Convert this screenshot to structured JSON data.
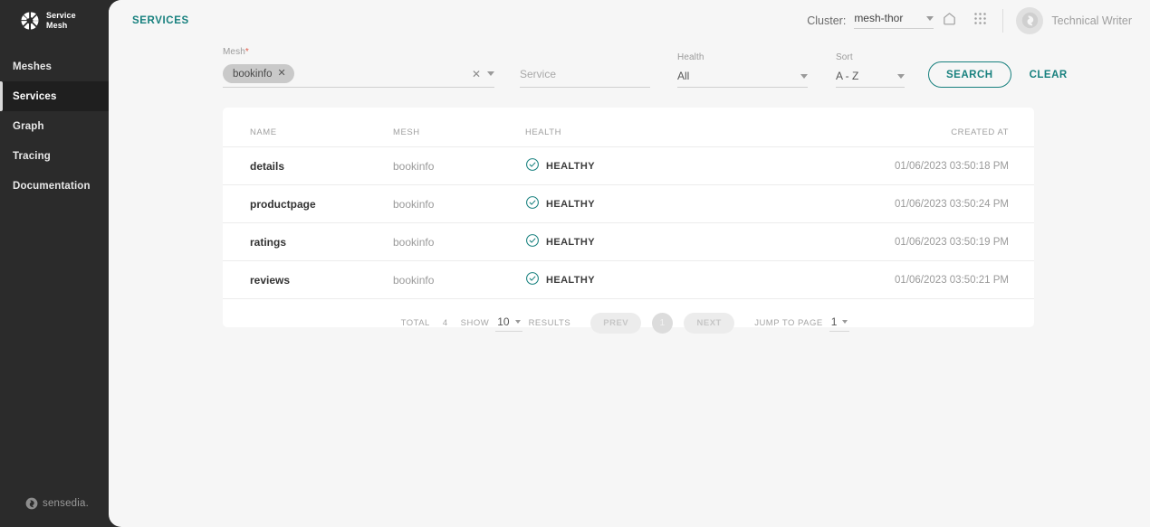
{
  "sidebar": {
    "brand": {
      "line1": "Service",
      "line2": "Mesh",
      "logo_icon": "service-mesh-logo-icon"
    },
    "items": [
      {
        "label": "Meshes",
        "active": false
      },
      {
        "label": "Services",
        "active": true
      },
      {
        "label": "Graph",
        "active": false
      },
      {
        "label": "Tracing",
        "active": false
      },
      {
        "label": "Documentation",
        "active": false
      }
    ],
    "footer": {
      "brand": "sensedia",
      "dot": ".",
      "logo_icon": "sensedia-logo-icon"
    }
  },
  "header": {
    "breadcrumb": "SERVICES",
    "cluster_label": "Cluster:",
    "cluster_value": "mesh-thor",
    "home_icon": "home-icon",
    "apps_icon": "apps-grid-icon",
    "user_name": "Technical Writer",
    "avatar_icon": "sensedia-avatar-icon"
  },
  "filters": {
    "mesh": {
      "label": "Mesh",
      "required": "*",
      "chip": "bookinfo",
      "chip_remove_icon": "chip-close-icon",
      "clear_icon": "clear-all-icon",
      "dropdown_icon": "chevron-down-icon"
    },
    "service": {
      "placeholder": "Service",
      "value": ""
    },
    "health": {
      "label": "Health",
      "value": "All"
    },
    "sort": {
      "label": "Sort",
      "value": "A - Z"
    },
    "search_label": "SEARCH",
    "clear_label": "CLEAR"
  },
  "table": {
    "columns": [
      "NAME",
      "MESH",
      "HEALTH",
      "CREATED AT"
    ],
    "health_icon": "check-circle-icon",
    "rows": [
      {
        "name": "details",
        "mesh": "bookinfo",
        "health": "HEALTHY",
        "created_at": "01/06/2023 03:50:18 PM"
      },
      {
        "name": "productpage",
        "mesh": "bookinfo",
        "health": "HEALTHY",
        "created_at": "01/06/2023 03:50:24 PM"
      },
      {
        "name": "ratings",
        "mesh": "bookinfo",
        "health": "HEALTHY",
        "created_at": "01/06/2023 03:50:19 PM"
      },
      {
        "name": "reviews",
        "mesh": "bookinfo",
        "health": "HEALTHY",
        "created_at": "01/06/2023 03:50:21 PM"
      }
    ]
  },
  "pagination": {
    "total_label": "TOTAL",
    "total_value": "4",
    "show_label": "SHOW",
    "page_size": "10",
    "results_label": "RESULTS",
    "prev_label": "PREV",
    "current_page": "1",
    "next_label": "NEXT",
    "jump_label": "JUMP TO PAGE",
    "jump_value": "1"
  },
  "colors": {
    "accent": "#17807e",
    "sidebar_bg": "#2b2b2b",
    "page_bg": "#f6f6f6",
    "card_bg": "#ffffff",
    "required": "#e05c4a"
  }
}
